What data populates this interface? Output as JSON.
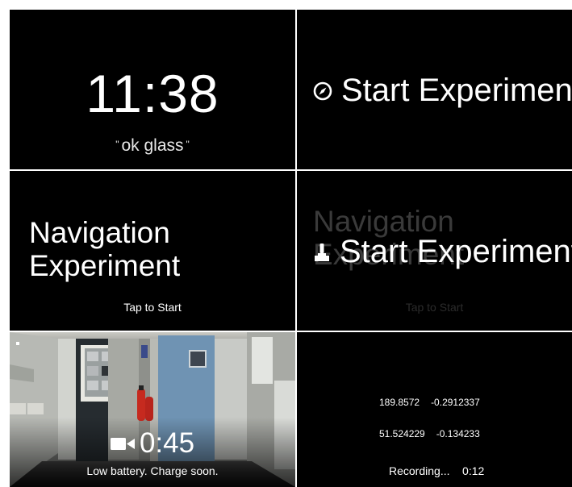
{
  "home_card": {
    "time": "11:38",
    "hotword": "ok glass",
    "quote_open": "\"",
    "quote_close": "\""
  },
  "start_card": {
    "icon": "compass-icon",
    "label": "Start Experiment"
  },
  "navigation_card": {
    "title_line1": "Navigation",
    "title_line2": "Experiment",
    "action": "Tap to Start"
  },
  "transition_card": {
    "ghost_title_line1": "Navigation",
    "ghost_title_line2": "Experiment",
    "ghost_action": "Tap to Start",
    "icon": "joystick-icon",
    "label": "Start Experiment"
  },
  "video_card": {
    "icon": "video-camera-icon",
    "duration": "0:45",
    "warning": "Low battery. Charge soon."
  },
  "recording_card": {
    "rows": [
      {
        "a": "189.8572",
        "b": "-0.2912337"
      },
      {
        "a": "51.524229",
        "b": "-0.134233"
      }
    ],
    "status_label": "Recording...",
    "elapsed": "0:12"
  }
}
